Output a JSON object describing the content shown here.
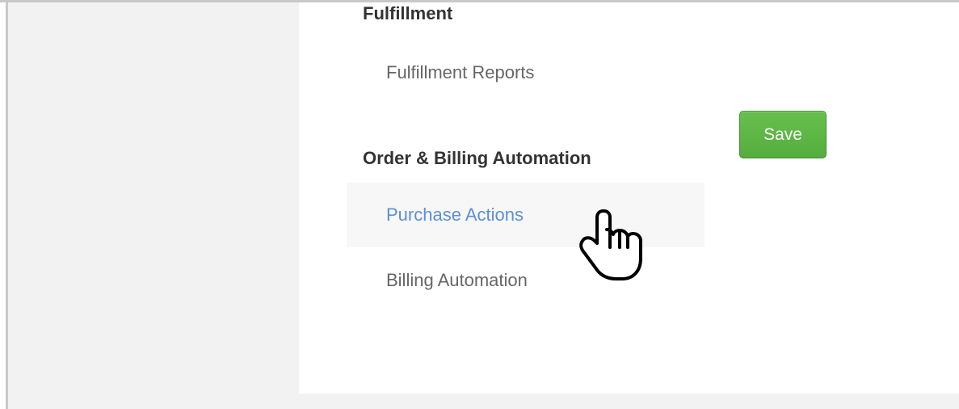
{
  "sections": {
    "fulfillment": {
      "heading": "Fulfillment",
      "links": {
        "fulfillment_reports": "Fulfillment Reports"
      }
    },
    "order_billing": {
      "heading": "Order & Billing Automation",
      "links": {
        "purchase_actions": "Purchase Actions",
        "billing_automation": "Billing Automation"
      }
    }
  },
  "actions": {
    "save_label": "Save"
  },
  "state": {
    "hovered_link": "Purchase Actions"
  },
  "colors": {
    "link_default": "#666666",
    "link_hover": "#5b8fd6",
    "save_button": "#5cb541",
    "sidebar_background": "#f2f2f2"
  },
  "icons": {
    "cursor": "hand-pointer-cursor-icon"
  }
}
